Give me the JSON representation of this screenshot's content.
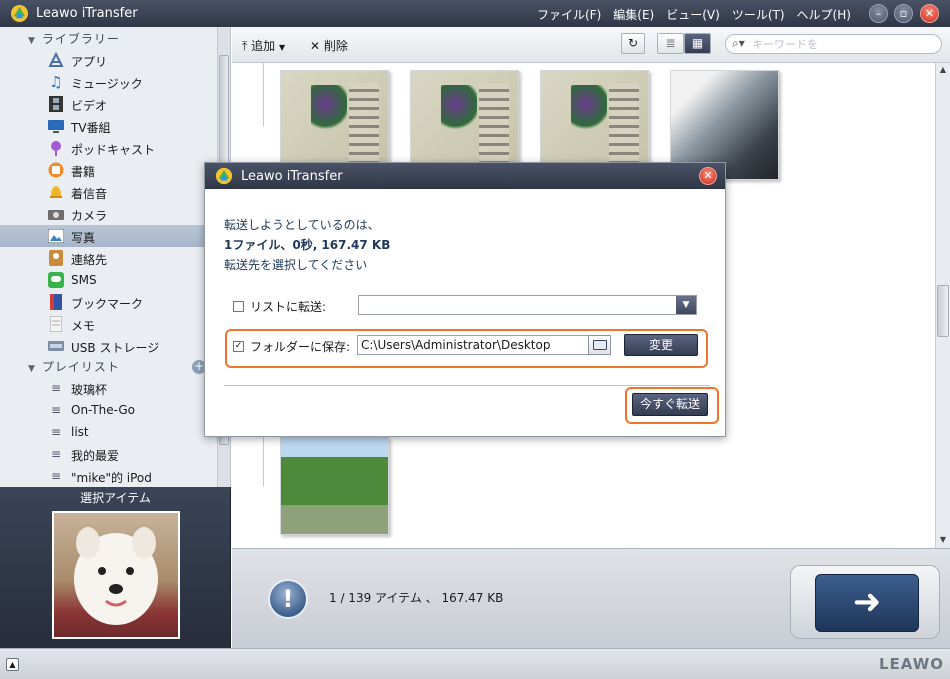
{
  "window": {
    "title": "Leawo iTransfer",
    "menu": [
      "ファイル(F)",
      "編集(E)",
      "ビュー(V)",
      "ツール(T)",
      "ヘルプ(H)"
    ]
  },
  "sidebar": {
    "library_label": "ライブラリー",
    "library_items": [
      {
        "label": "アプリ",
        "icon": "apps-icon"
      },
      {
        "label": "ミュージック",
        "icon": "music-note-icon"
      },
      {
        "label": "ビデオ",
        "icon": "film-icon"
      },
      {
        "label": "TV番組",
        "icon": "tv-icon"
      },
      {
        "label": "ポッドキャスト",
        "icon": "podcast-icon"
      },
      {
        "label": "書籍",
        "icon": "book-icon"
      },
      {
        "label": "着信音",
        "icon": "bell-icon"
      },
      {
        "label": "カメラ",
        "icon": "camera-icon"
      },
      {
        "label": "写真",
        "icon": "photo-icon"
      },
      {
        "label": "連絡先",
        "icon": "contacts-icon"
      },
      {
        "label": "SMS",
        "icon": "sms-icon"
      },
      {
        "label": "ブックマーク",
        "icon": "bookmark-icon"
      },
      {
        "label": "メモ",
        "icon": "note-icon"
      },
      {
        "label": "USB ストレージ",
        "icon": "usb-icon"
      }
    ],
    "playlist_label": "プレイリスト",
    "playlists": [
      "玻璃杯",
      "On-The-Go",
      "list",
      "我的最爱",
      "\"mike\"的 iPod"
    ],
    "selected_item_title": "選択アイテム"
  },
  "toolbar": {
    "add_label": "追加",
    "delete_label": "削除",
    "search_placeholder": "キーワードを"
  },
  "info": {
    "summary": "1 / 139 アイテム 、 167.47 KB"
  },
  "dialog": {
    "title": "Leawo iTransfer",
    "line1": "転送しようとしているのは、",
    "line2": "1ファイル、0秒, 167.47 KB",
    "line3": "転送先を選択してください",
    "list_option_label": "リストに転送:",
    "list_checked": false,
    "folder_option_label": "フォルダーに保存:",
    "folder_checked": true,
    "folder_path": "C:\\Users\\Administrator\\Desktop",
    "change_button": "変更",
    "transfer_now_button": "今すぐ転送"
  },
  "brand": "LEAWO",
  "colors": {
    "accent_highlight": "#f0752a",
    "titlebar": "#3a4254",
    "selection": "#b1bfd0"
  }
}
